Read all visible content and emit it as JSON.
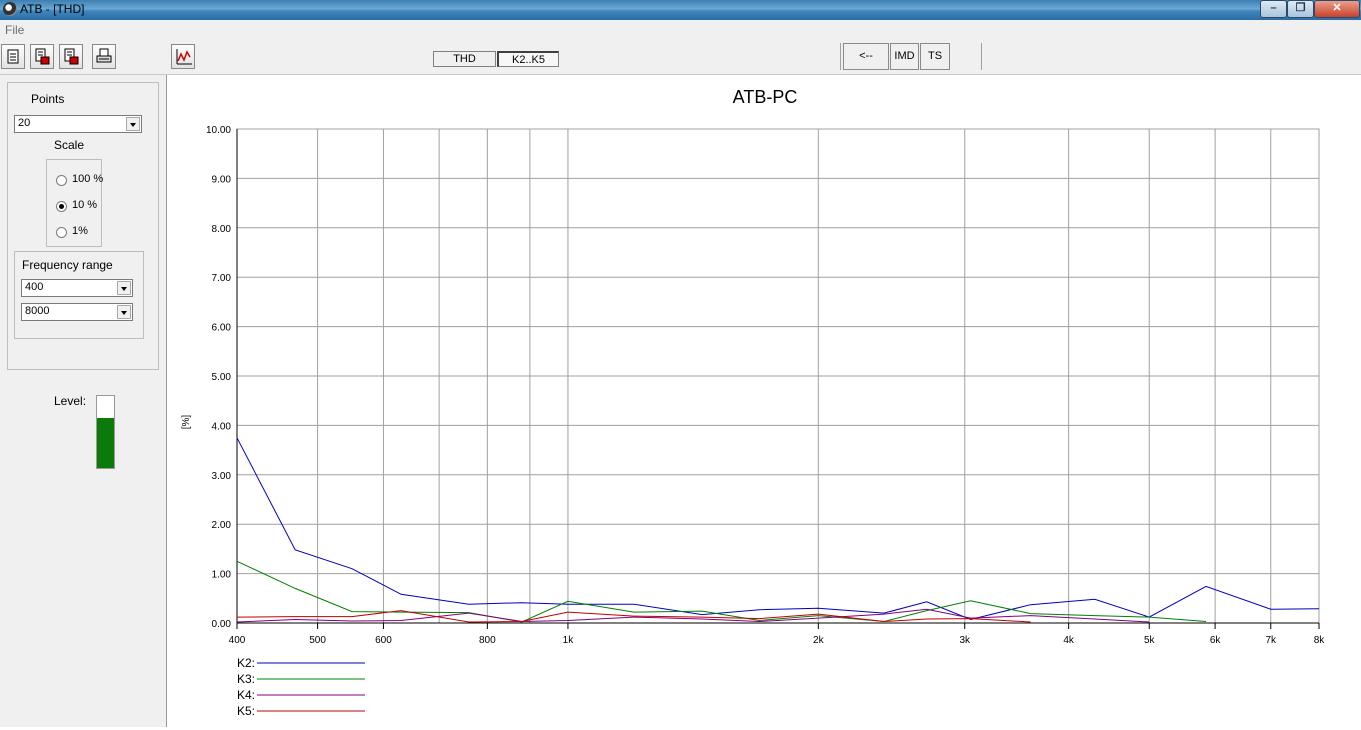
{
  "window": {
    "title": "ATB - [THD]",
    "min_icon": "minimize-icon",
    "max_icon": "restore-icon",
    "close_icon": "close-icon"
  },
  "menu": {
    "file": "File"
  },
  "toolbar": {
    "buttons": [
      "new-icon",
      "save-icon",
      "save-as-icon",
      "print-icon"
    ],
    "graph_button": "graph-icon",
    "tabs": [
      "THD",
      "K2..K5"
    ],
    "active_tab": "K2..K5",
    "nav": {
      "back": "<--",
      "imd": "IMD",
      "ts": "TS"
    }
  },
  "left": {
    "points_label": "Points",
    "points_value": "20",
    "scale_label": "Scale",
    "scale_options": [
      "100 %",
      "10 %",
      "1%"
    ],
    "scale_selected": "10 %",
    "freq_label": "Frequency range",
    "freq_from": "400",
    "freq_to": "8000",
    "level_label": "Level:",
    "level_fraction": 0.69,
    "level_color": "#0b7a0b"
  },
  "chart_data": {
    "type": "line",
    "title": "ATB-PC",
    "ylabel": "[%]",
    "xscale": "log",
    "xlim": [
      400,
      8000
    ],
    "ylim": [
      0,
      10
    ],
    "grid": true,
    "yticks": [
      0,
      1,
      2,
      3,
      4,
      5,
      6,
      7,
      8,
      9,
      10
    ],
    "ytick_labels": [
      "0.00",
      "1.00",
      "2.00",
      "3.00",
      "4.00",
      "5.00",
      "6.00",
      "7.00",
      "8.00",
      "9.00",
      "10.00"
    ],
    "xgrid": [
      500,
      600,
      700,
      800,
      900,
      1000,
      2000,
      3000,
      4000,
      5000,
      6000,
      7000
    ],
    "xticks": [
      400,
      500,
      600,
      800,
      1000,
      2000,
      3000,
      4000,
      5000,
      6000,
      7000,
      8000
    ],
    "xtick_labels": [
      "400",
      "500",
      "600",
      "800",
      "1k",
      "2k",
      "3k",
      "4k",
      "5k",
      "6k",
      "7k",
      "8k"
    ],
    "series": [
      {
        "name": "K2:",
        "color": "#0000c0",
        "x": [
          400,
          470,
          550,
          630,
          760,
          880,
          1000,
          1200,
          1450,
          1700,
          2000,
          2400,
          2700,
          3050,
          3600,
          4300,
          5000,
          5850,
          7000,
          8000
        ],
        "y": [
          3.75,
          1.48,
          1.1,
          0.58,
          0.38,
          0.41,
          0.38,
          0.38,
          0.17,
          0.27,
          0.3,
          0.2,
          0.43,
          0.07,
          0.37,
          0.48,
          0.12,
          0.74,
          0.28,
          0.29
        ]
      },
      {
        "name": "K3:",
        "color": "#008000",
        "x": [
          400,
          470,
          550,
          630,
          760,
          880,
          1000,
          1200,
          1450,
          1700,
          2000,
          2400,
          2700,
          3050,
          3600,
          4300,
          5000,
          5850
        ],
        "y": [
          1.25,
          0.7,
          0.23,
          0.22,
          0.21,
          0.02,
          0.44,
          0.22,
          0.24,
          0.05,
          0.15,
          0.03,
          0.25,
          0.45,
          0.19,
          0.15,
          0.12,
          0.03
        ]
      },
      {
        "name": "K4:",
        "color": "#800080",
        "x": [
          400,
          470,
          550,
          630,
          760,
          880,
          1000,
          1200,
          1450,
          1700,
          2000,
          2400,
          2700,
          3050,
          3600,
          4300,
          5000
        ],
        "y": [
          0.02,
          0.07,
          0.04,
          0.05,
          0.2,
          0.03,
          0.05,
          0.12,
          0.08,
          0.03,
          0.1,
          0.18,
          0.28,
          0.1,
          0.15,
          0.08,
          0.02
        ]
      },
      {
        "name": "K5:",
        "color": "#c00000",
        "x": [
          400,
          470,
          550,
          630,
          760,
          880,
          1000,
          1200,
          1450,
          1700,
          2000,
          2400,
          2700,
          3050,
          3600
        ],
        "y": [
          0.12,
          0.13,
          0.13,
          0.25,
          0.02,
          0.03,
          0.22,
          0.14,
          0.12,
          0.09,
          0.18,
          0.03,
          0.08,
          0.09,
          0.02
        ]
      }
    ]
  }
}
